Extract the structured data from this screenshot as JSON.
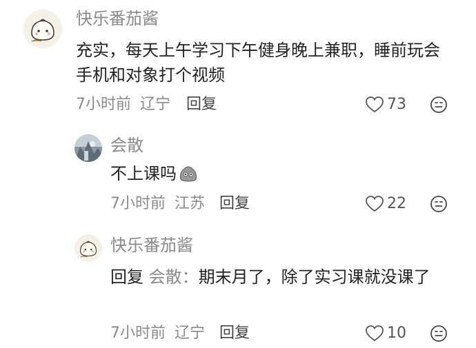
{
  "comments": [
    {
      "author": "快乐番茄酱",
      "text": "充实，每天上午学习下午健身晚上兼职，睡前玩会手机和对象打个视频",
      "time": "7小时前",
      "location": "辽宁",
      "reply_label": "回复",
      "likes": "73"
    },
    {
      "author": "会散",
      "text": "不上课吗",
      "time": "7小时前",
      "location": "江苏",
      "reply_label": "回复",
      "likes": "22"
    },
    {
      "author": "快乐番茄酱",
      "reply_prefix": "回复",
      "reply_to": "会散",
      "reply_colon": "：",
      "text": "期末月了，除了实习课就没课了",
      "time": "7小时前",
      "location": "辽宁",
      "reply_label": "回复",
      "likes": "10"
    }
  ],
  "icons": {
    "like": "heart-outline-icon",
    "emoji": "neutral-face-icon",
    "inline_emoji": "gray-blob-emoji"
  },
  "colors": {
    "meta_gray": "#8a8a8a",
    "text": "#222222"
  }
}
